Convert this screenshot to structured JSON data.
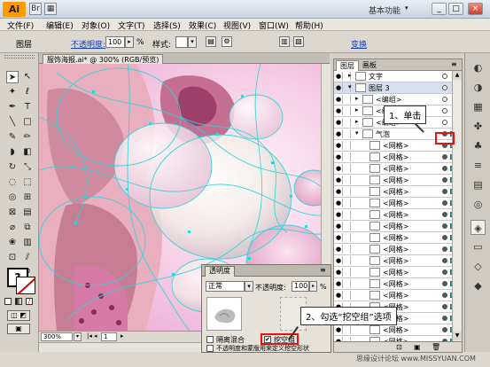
{
  "title_bar": {
    "app_logo": "Ai",
    "workspace": "基本功能",
    "minimize": "_",
    "restore": "□",
    "close": "×"
  },
  "menu": [
    "文件(F)",
    "编辑(E)",
    "对象(O)",
    "文字(T)",
    "选择(S)",
    "效果(C)",
    "视图(V)",
    "窗口(W)",
    "帮助(H)"
  ],
  "control_bar": {
    "label": "图层",
    "opacity_label": "不透明度:",
    "opacity_value": "100",
    "unit": "%",
    "style_label": "样式:",
    "transform": "变换"
  },
  "document": {
    "tab": "服饰海报.ai* @ 300% (RGB/预览)",
    "zoom": "300%",
    "page": "1"
  },
  "layers_panel": {
    "tabs": [
      "图层",
      "画板"
    ],
    "rows": [
      {
        "name": "文字",
        "indent": 0,
        "arrow": "▸",
        "selected": false
      },
      {
        "name": "图层 3",
        "indent": 0,
        "arrow": "▾",
        "selected": true
      },
      {
        "name": "<编组>",
        "indent": 1,
        "arrow": "▸",
        "selected": false
      },
      {
        "name": "<编组>",
        "indent": 1,
        "arrow": "▸",
        "selected": false
      },
      {
        "name": "<编组>",
        "indent": 1,
        "arrow": "▸",
        "selected": false
      },
      {
        "name": "气泡",
        "indent": 1,
        "arrow": "▾",
        "selected": false
      },
      {
        "name": "<网格>",
        "indent": 2,
        "arrow": "",
        "selected": false
      },
      {
        "name": "<网格>",
        "indent": 2,
        "arrow": "",
        "selected": false
      },
      {
        "name": "<网格>",
        "indent": 2,
        "arrow": "",
        "selected": false
      },
      {
        "name": "<网格>",
        "indent": 2,
        "arrow": "",
        "selected": false
      },
      {
        "name": "<网格>",
        "indent": 2,
        "arrow": "",
        "selected": false
      },
      {
        "name": "<网格>",
        "indent": 2,
        "arrow": "",
        "selected": false
      },
      {
        "name": "<网格>",
        "indent": 2,
        "arrow": "",
        "selected": false
      },
      {
        "name": "<网格>",
        "indent": 2,
        "arrow": "",
        "selected": false
      },
      {
        "name": "<网格>",
        "indent": 2,
        "arrow": "",
        "selected": false
      },
      {
        "name": "<网格>",
        "indent": 2,
        "arrow": "",
        "selected": false
      },
      {
        "name": "<网格>",
        "indent": 2,
        "arrow": "",
        "selected": false
      },
      {
        "name": "<网格>",
        "indent": 2,
        "arrow": "",
        "selected": false
      },
      {
        "name": "<网格>",
        "indent": 2,
        "arrow": "",
        "selected": false
      },
      {
        "name": "<网格>",
        "indent": 2,
        "arrow": "",
        "selected": false
      },
      {
        "name": "<网格>",
        "indent": 2,
        "arrow": "",
        "selected": false
      },
      {
        "name": "<网格>",
        "indent": 2,
        "arrow": "",
        "selected": false
      },
      {
        "name": "<网格>",
        "indent": 2,
        "arrow": "",
        "selected": false
      },
      {
        "name": "<网格>",
        "indent": 2,
        "arrow": "",
        "selected": false
      }
    ]
  },
  "transparency_panel": {
    "tab": "透明度",
    "blend_mode": "正常",
    "opacity_label": "不透明度:",
    "opacity_value": "100",
    "unit": "%",
    "isolate_blending": "隔离混合",
    "knockout_group": "挖空组",
    "knockout_checked": true,
    "opacity_define": "不透明度和蒙版用来定义挖空形状"
  },
  "callouts": {
    "step1": "1、单击",
    "step2": "2、勾选“挖空组”选项"
  },
  "watermark": "思缘设计论坛 www.MISSYUAN.COM",
  "colors": {
    "accent": "#1fa6b5",
    "highlight": "#e11111",
    "layer_selected": "#d4e0f0"
  },
  "icons": [
    "selection-arrow-icon",
    "direct-selection-icon",
    "magic-wand-icon",
    "lasso-icon",
    "pen-icon",
    "type-icon",
    "line-icon",
    "rectangle-icon",
    "paintbrush-icon",
    "pencil-icon",
    "eye-icon",
    "target-icon",
    "swatches-icon",
    "brushes-icon",
    "symbols-icon",
    "layers-dock-icon"
  ]
}
